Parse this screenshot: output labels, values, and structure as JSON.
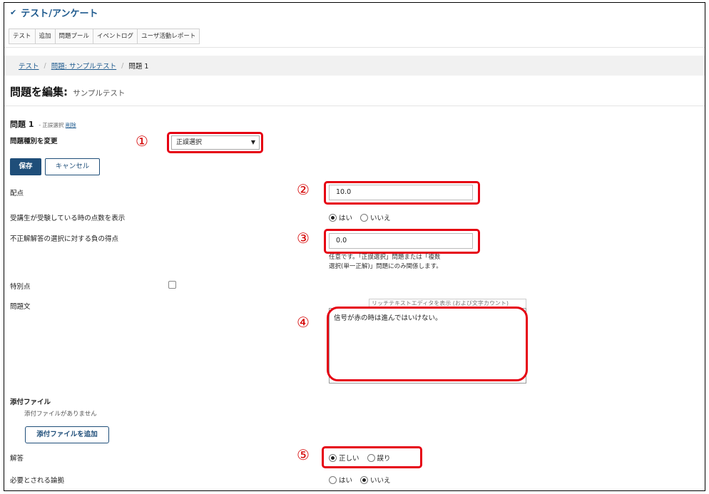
{
  "app": {
    "title": "テスト/アンケート"
  },
  "tabs": [
    {
      "label": "テスト"
    },
    {
      "label": "追加"
    },
    {
      "label": "問題プール"
    },
    {
      "label": "イベントログ"
    },
    {
      "label": "ユーザ活動レポート"
    }
  ],
  "breadcrumb": {
    "items": [
      "テスト",
      "問題: サンプルテスト",
      "問題 1"
    ],
    "separator": "/"
  },
  "page": {
    "heading": "問題を編集:",
    "subheading": "サンプルテスト"
  },
  "question": {
    "title": "問題 1",
    "type_note": "- 正誤選択",
    "delete_link": "削除",
    "change_type_label": "問題種別を変更",
    "type_value": "正誤選択"
  },
  "actions": {
    "save": "保存",
    "cancel": "キャンセル"
  },
  "points": {
    "label": "配点",
    "value": "10.0"
  },
  "show_points": {
    "label": "受講生が受験している時の点数を表示",
    "yes": "はい",
    "no": "いいえ",
    "selected": "yes"
  },
  "negative_points": {
    "label": "不正解解答の選択に対する負の得点",
    "value": "0.0",
    "help_line1": "任意です。「正誤選択」問題または「複数",
    "help_line2": "選択(単一正解)」問題にのみ関係します。"
  },
  "extra_credit": {
    "label": "特別点"
  },
  "question_text": {
    "label": "問題文",
    "editor_link": "リッチテキストエディタを表示 (および文字カウント)",
    "value": "信号が赤の時は進んではいけない。"
  },
  "attachments": {
    "label": "添付ファイル",
    "empty": "添付ファイルがありません",
    "add_button": "添付ファイルを追加"
  },
  "answer": {
    "label": "解答",
    "true_label": "正しい",
    "false_label": "誤り",
    "selected": "true"
  },
  "rationale": {
    "label": "必要とされる論拠",
    "yes": "はい",
    "no": "いいえ",
    "selected": "no"
  },
  "annotations": {
    "n1": "①",
    "n2": "②",
    "n3": "③",
    "n4": "④",
    "n5": "⑤"
  },
  "colors": {
    "accent": "#1e5a8e",
    "primary_button": "#1f4e79",
    "annotation_red": "#e60012"
  }
}
